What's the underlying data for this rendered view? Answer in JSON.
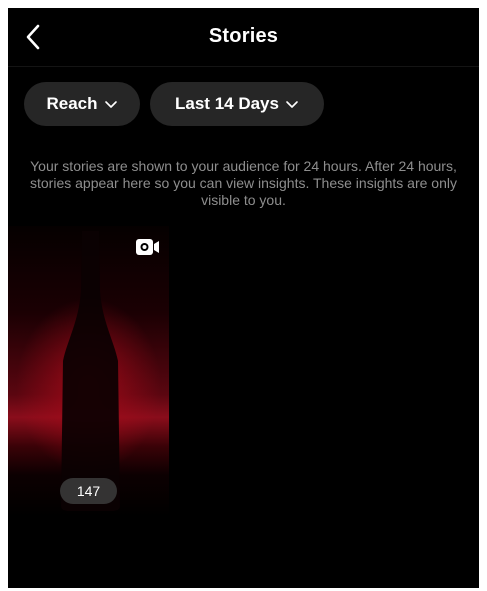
{
  "header": {
    "title": "Stories",
    "back_icon": "chevron-left-icon"
  },
  "filters": {
    "metric_label": "Reach",
    "range_label": "Last 14 Days",
    "dropdown_icon": "chevron-down-icon"
  },
  "info_text": "Your stories are shown to your audience for 24 hours. After 24 hours, stories appear here so you can view insights. These insights are only visible to you.",
  "stories": [
    {
      "type_icon": "video-camera-icon",
      "count": "147"
    }
  ],
  "colors": {
    "background": "#000000",
    "pill": "#262626",
    "muted_text": "#8e8e8e",
    "accent_red": "#8a0d1b"
  }
}
